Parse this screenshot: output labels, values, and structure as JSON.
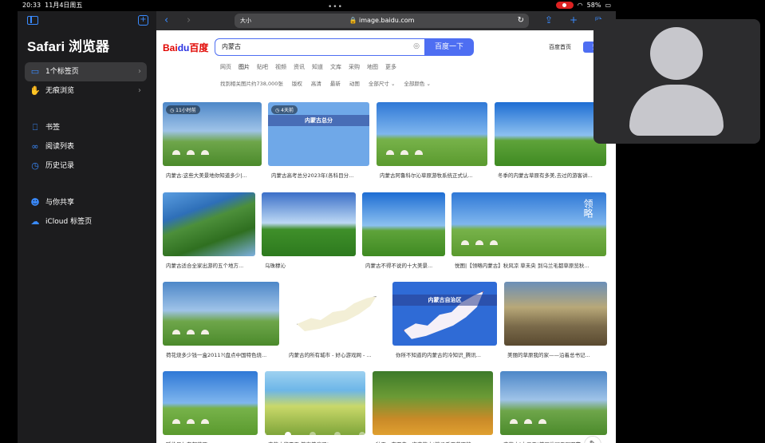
{
  "status": {
    "time": "20:33",
    "date": "11月4日周五",
    "battery": "58%"
  },
  "sidebar": {
    "title": "Safari 浏览器",
    "items": [
      {
        "label": "1个标签页",
        "icon": "tab-icon"
      },
      {
        "label": "无痕浏览",
        "icon": "hand-icon"
      },
      {
        "label": "书签",
        "icon": "bookmark-icon"
      },
      {
        "label": "阅读列表",
        "icon": "glasses-icon"
      },
      {
        "label": "历史记录",
        "icon": "clock-icon"
      },
      {
        "label": "与你共享",
        "icon": "people-icon"
      },
      {
        "label": "iCloud 标签页",
        "icon": "cloud-icon"
      }
    ]
  },
  "browser": {
    "text_size_label": "大小",
    "url": "image.baidu.com"
  },
  "page": {
    "logo": {
      "left": "Bai",
      "paw": "du",
      "right": "百度"
    },
    "search_value": "内蒙古",
    "search_button": "百度一下",
    "header_link": "百度首页",
    "header_button": "登",
    "tabs": [
      "网页",
      "图片",
      "贴吧",
      "视频",
      "资讯",
      "知道",
      "文库",
      "采购",
      "地图",
      "更多"
    ],
    "filters": [
      "找到相关图片约738,000张",
      "版权",
      "高清",
      "最新",
      "动图",
      "全部尺寸 ⌄",
      "全部颜色 ⌄"
    ]
  },
  "results": [
    {
      "caption": "内蒙古:这些大美景地你知道多少|...",
      "badge": "11小时前",
      "style": "sky1"
    },
    {
      "caption": "内蒙古高考总分2023年(各科目分...",
      "badge": "4天前",
      "banner": "内蒙古总分",
      "style": "cartoon"
    },
    {
      "caption": "内蒙古阿鲁科尔沁草原游牧系统正式认...",
      "style": "sky2"
    },
    {
      "caption": "冬季的内蒙古草原有多美,去过的游客讲...",
      "style": "sky4"
    },
    {
      "caption": "内蒙古适合全家出游的五个地方...",
      "style": "lake"
    },
    {
      "caption": "乌珠穆沁",
      "style": "sky3"
    },
    {
      "caption": "内蒙古不得不说的十大美景...",
      "style": "sky4"
    },
    {
      "caption": "悦图|【领略内蒙古】秋风凉 草未央 到乌兰毛都草原览秋...",
      "overlay": "领略",
      "style": "sky2"
    },
    {
      "caption": "荷花烧多少钱一盒2011?(盘点中国特色烧...",
      "style": "sky1"
    },
    {
      "caption": "内蒙古的所有城市 - 好心游戏网 - ...",
      "style": "map"
    },
    {
      "caption": "你所不知道的内蒙古的冷知识_腾讯...",
      "banner": "内蒙古自治区",
      "style": "mapblue"
    },
    {
      "caption": "美丽的草原我的家——沿着总书记...",
      "style": "brown"
    },
    {
      "caption": "呼伦贝尔东部草原",
      "style": "sky2"
    },
    {
      "caption": "内蒙古的夏天,简直美疯了!",
      "style": "fields"
    },
    {
      "caption": "秋天一定要去一次内蒙古!躺寻千里草原的...",
      "style": "autumn"
    },
    {
      "caption": "内蒙古\"十三五\"美丽发展五圈双赢",
      "style": "sky1"
    }
  ]
}
